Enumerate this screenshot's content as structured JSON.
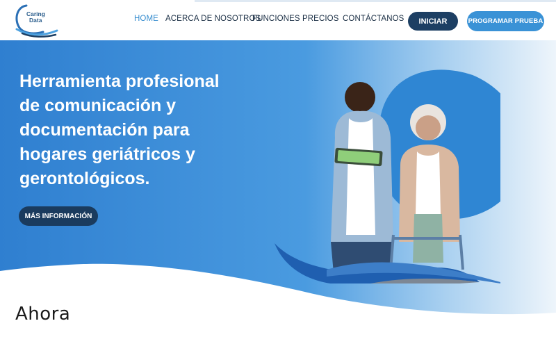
{
  "header": {
    "logo": {
      "line1": "Caring",
      "line2": "Data"
    },
    "nav": [
      {
        "label": "HOME",
        "active": true
      },
      {
        "label": "ACERCA DE NOSOTROS",
        "active": false
      },
      {
        "label": "FUNCIONES",
        "active": false
      },
      {
        "label": "PRECIOS",
        "active": false
      },
      {
        "label": "CONTÁCTANOS",
        "active": false
      }
    ],
    "login_label": "INICIAR",
    "trial_label": "PROGRAMAR PRUEBA"
  },
  "hero": {
    "title_lines": [
      "Herramienta profesional",
      "de comunicación y",
      "documentación para",
      "hogares geriátricos y",
      "gerontológicos."
    ],
    "cta_label": "MÁS INFORMACIÓN",
    "image_description": "caregiver-and-elderly-woman-illustration"
  },
  "section": {
    "title": "Ahora"
  },
  "colors": {
    "brand_dark": "#1d3f63",
    "brand_blue": "#3a92d6",
    "nav_active": "#3a8fd0",
    "hero_gradient_start": "#2f7fd0",
    "hero_gradient_end": "#eef5fb"
  }
}
